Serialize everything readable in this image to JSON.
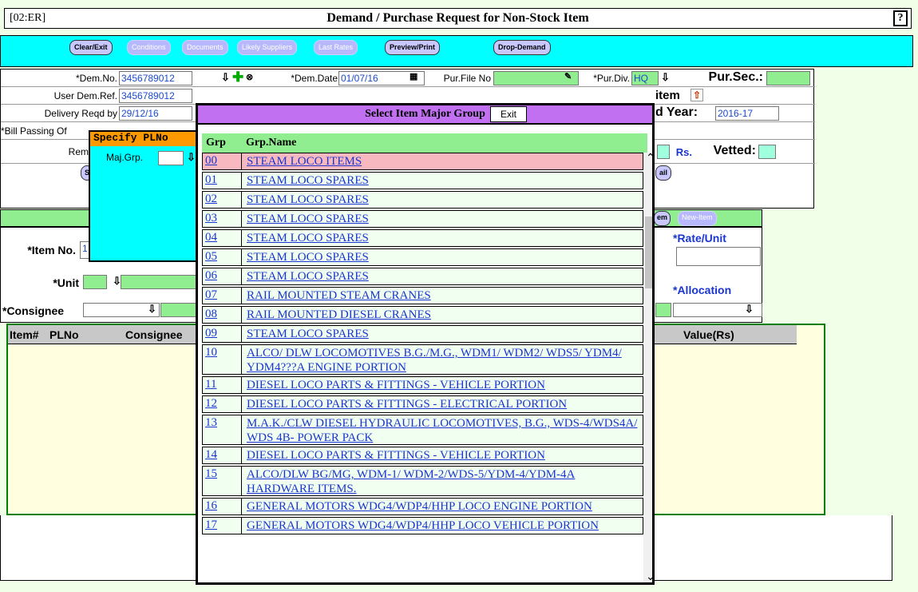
{
  "window": {
    "code": "[02:ER]",
    "title": "Demand / Purchase Request for Non-Stock Item",
    "help": "?"
  },
  "toolbar": {
    "clear_exit": "Clear/Exit",
    "conditions": "Conditions",
    "documents": "Documents",
    "likely_suppliers": "Likely Suppliers",
    "last_rates": "Last Rates",
    "preview_print": "Preview/Print",
    "drop_demand": "Drop-Demand"
  },
  "header": {
    "dem_no_label": "*Dem.No.",
    "dem_no": "3456789012",
    "dem_date_label": "*Dem.Date",
    "dem_date": "01/07/16",
    "pur_file_label": "Pur.File No",
    "pur_div_label": "*Pur.Div.",
    "pur_div": "HQ",
    "pur_sec_label": "Pur.Sec.:",
    "user_dem_label": "User Dem.Ref.",
    "user_dem": "3456789012",
    "item_label": "item",
    "delivery_label": "Delivery Reqd by",
    "delivery": "29/12/16",
    "year_label": "d Year:",
    "year": "2016-17",
    "bill_label": "*Bill Passing Of",
    "rem_label": "Rem",
    "rs_label": "Rs.",
    "vetted_label": "Vetted:",
    "s_btn": "S",
    "detail_btn": "ail"
  },
  "item": {
    "em_btn": "em",
    "new_item_btn": "New-Item",
    "item_no_label": "*Item No.",
    "item_no": "1",
    "rate_label": "*Rate/Unit",
    "unit_label": "*Unit",
    "allocation_label": "*Allocation",
    "consignee_label": "*Consignee"
  },
  "grid": {
    "col_item": "Item#",
    "col_plno": "PLNo",
    "col_consignee": "Consignee",
    "col_value": "Value(Rs)"
  },
  "specify": {
    "title": "Specify PLNo",
    "majgrp_label": "Maj.Grp."
  },
  "popup": {
    "title": "Select Item Major Group",
    "exit": "Exit",
    "col_grp": "Grp",
    "col_name": "Grp.Name",
    "rows": [
      {
        "grp": "00",
        "name": "STEAM LOCO ITEMS"
      },
      {
        "grp": "01",
        "name": "STEAM LOCO SPARES"
      },
      {
        "grp": "02",
        "name": "STEAM LOCO SPARES"
      },
      {
        "grp": "03",
        "name": "STEAM LOCO SPARES"
      },
      {
        "grp": "04",
        "name": "STEAM LOCO SPARES"
      },
      {
        "grp": "05",
        "name": "STEAM LOCO SPARES"
      },
      {
        "grp": "06",
        "name": "STEAM LOCO SPARES"
      },
      {
        "grp": "07",
        "name": "RAIL MOUNTED STEAM CRANES"
      },
      {
        "grp": "08",
        "name": "RAIL MOUNTED DIESEL CRANES"
      },
      {
        "grp": "09",
        "name": "STEAM LOCO SPARES"
      },
      {
        "grp": "10",
        "name": "ALCO/ DLW LOCOMOTIVES B.G./M.G., WDM1/ WDM2/ WDS5/ YDM4/ YDM4???A ENGINE PORTION"
      },
      {
        "grp": "11",
        "name": "DIESEL LOCO PARTS & FITTINGS - VEHICLE PORTION"
      },
      {
        "grp": "12",
        "name": "DIESEL LOCO PARTS & FITTINGS - ELECTRICAL PORTION"
      },
      {
        "grp": "13",
        "name": "M.A.K./CLW DIESEL HYDRAULIC LOCOMOTIVES, B.G., WDS-4/WDS4A/ WDS 4B- POWER PACK"
      },
      {
        "grp": "14",
        "name": "DIESEL LOCO PARTS & FITTINGS - VEHICLE PORTION"
      },
      {
        "grp": "15",
        "name": "ALCO/DLW BG/MG, WDM-1/ WDM-2/WDS-5/YDM-4/YDM-4A HARDWARE ITEMS."
      },
      {
        "grp": "16",
        "name": "GENERAL MOTORS WDG4/WDP4/HHP LOCO ENGINE PORTION"
      },
      {
        "grp": "17",
        "name": "GENERAL MOTORS WDG4/WDP4/HHP LOCO VEHICLE PORTION"
      }
    ]
  },
  "colors": {
    "toolbar": "#00ffff",
    "green": "#90ee90",
    "popup_title": "#c070f0",
    "selected_row": "#f8b8c0",
    "link": "#1a35d0"
  }
}
